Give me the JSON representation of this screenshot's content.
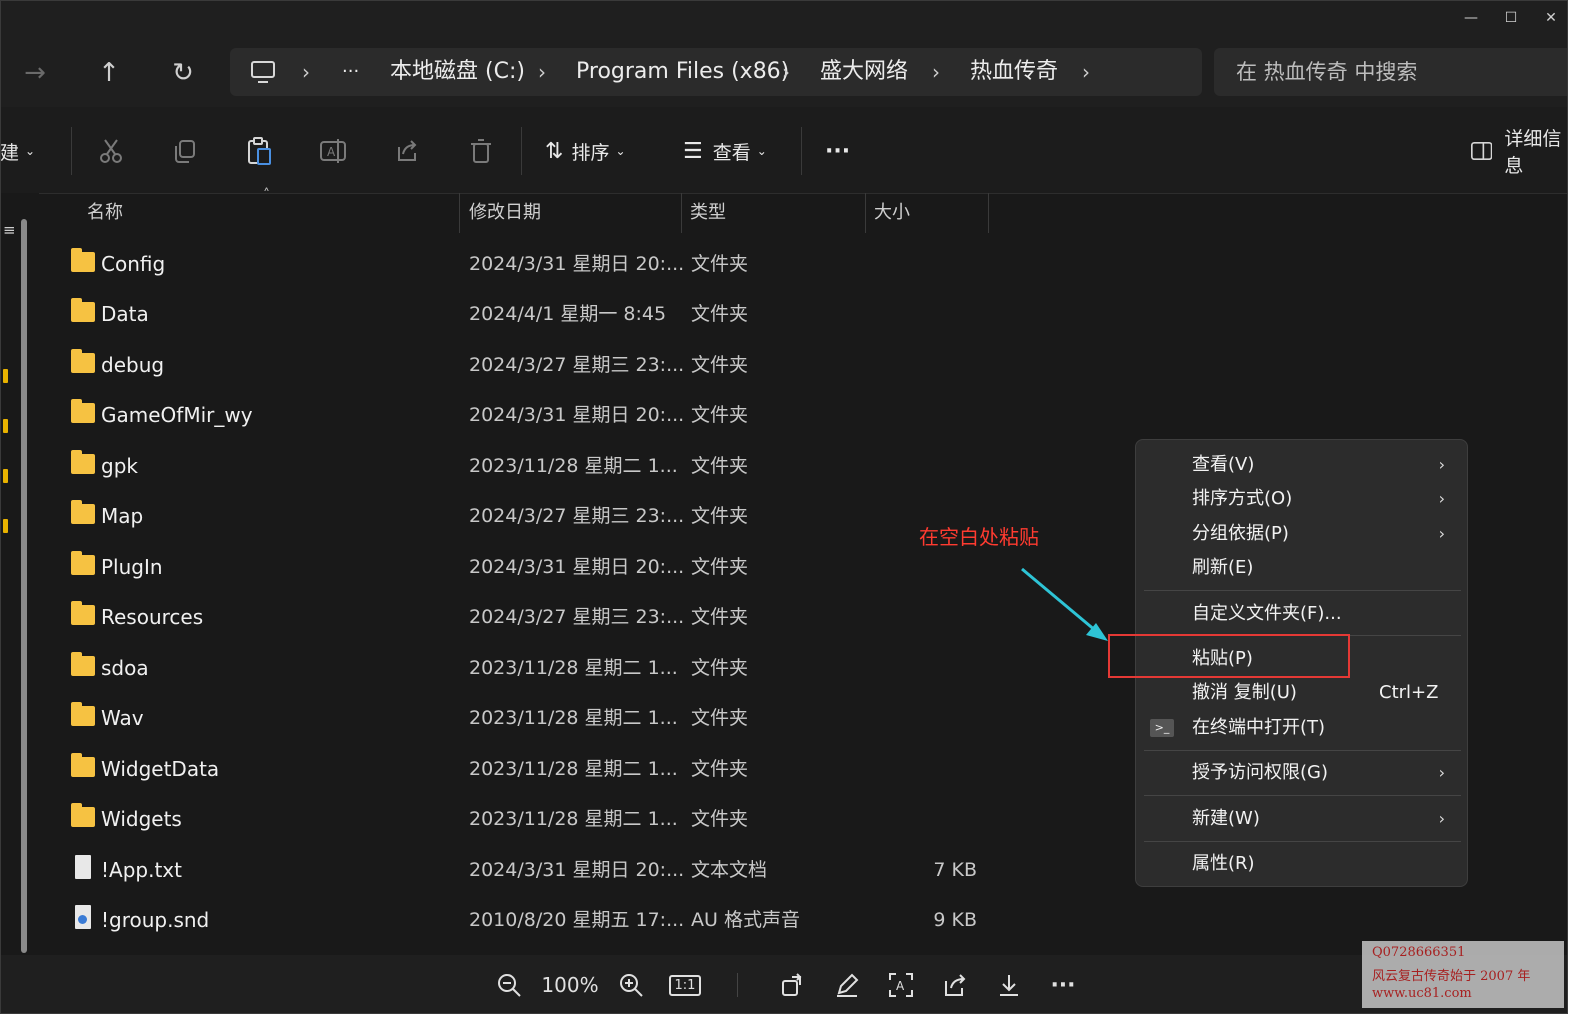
{
  "window": {
    "controls": {
      "minimize": "—",
      "maximize": "☐",
      "close": "✕"
    }
  },
  "nav": {
    "back_icon": "←",
    "forward_icon": "→",
    "up_icon": "↑",
    "refresh_icon": "↻"
  },
  "address": {
    "more": "···",
    "segments": [
      "本地磁盘 (C:)",
      "Program Files (x86)",
      "盛大网络",
      "热血传奇"
    ]
  },
  "search": {
    "placeholder": "在 热血传奇 中搜索"
  },
  "toolbar": {
    "new_label": "新建",
    "sort_label": "排序",
    "view_label": "查看",
    "more_label": "···",
    "details_label": "详细信息"
  },
  "columns": {
    "name": "名称",
    "date": "修改日期",
    "type": "类型",
    "size": "大小"
  },
  "files": [
    {
      "name": "Config",
      "date": "2024/3/31 星期日 20:...",
      "type": "文件夹",
      "size": "",
      "kind": "folder"
    },
    {
      "name": "Data",
      "date": "2024/4/1 星期一 8:45",
      "type": "文件夹",
      "size": "",
      "kind": "folder"
    },
    {
      "name": "debug",
      "date": "2024/3/27 星期三 23:...",
      "type": "文件夹",
      "size": "",
      "kind": "folder"
    },
    {
      "name": "GameOfMir_wy",
      "date": "2024/3/31 星期日 20:...",
      "type": "文件夹",
      "size": "",
      "kind": "folder"
    },
    {
      "name": "gpk",
      "date": "2023/11/28 星期二 1...",
      "type": "文件夹",
      "size": "",
      "kind": "folder"
    },
    {
      "name": "Map",
      "date": "2024/3/27 星期三 23:...",
      "type": "文件夹",
      "size": "",
      "kind": "folder"
    },
    {
      "name": "PlugIn",
      "date": "2024/3/31 星期日 20:...",
      "type": "文件夹",
      "size": "",
      "kind": "folder"
    },
    {
      "name": "Resources",
      "date": "2024/3/27 星期三 23:...",
      "type": "文件夹",
      "size": "",
      "kind": "folder"
    },
    {
      "name": "sdoa",
      "date": "2023/11/28 星期二 1...",
      "type": "文件夹",
      "size": "",
      "kind": "folder"
    },
    {
      "name": "Wav",
      "date": "2023/11/28 星期二 1...",
      "type": "文件夹",
      "size": "",
      "kind": "folder"
    },
    {
      "name": "WidgetData",
      "date": "2023/11/28 星期二 1...",
      "type": "文件夹",
      "size": "",
      "kind": "folder"
    },
    {
      "name": "Widgets",
      "date": "2023/11/28 星期二 1...",
      "type": "文件夹",
      "size": "",
      "kind": "folder"
    },
    {
      "name": "!App.txt",
      "date": "2024/3/31 星期日 20:...",
      "type": "文本文档",
      "size": "7 KB",
      "kind": "text"
    },
    {
      "name": "!group.snd",
      "date": "2010/8/20 星期五 17:...",
      "type": "AU 格式声音",
      "size": "9 KB",
      "kind": "sound"
    }
  ],
  "context_menu": {
    "view": "查看(V)",
    "sort": "排序方式(O)",
    "group": "分组依据(P)",
    "refresh": "刷新(E)",
    "customize": "自定义文件夹(F)...",
    "paste": "粘贴(P)",
    "undo": "撤消 复制(U)",
    "undo_shortcut": "Ctrl+Z",
    "terminal": "在终端中打开(T)",
    "access": "授予访问权限(G)",
    "new": "新建(W)",
    "properties": "属性(R)"
  },
  "annotation": {
    "text": "在空白处粘贴"
  },
  "viewer_bar": {
    "zoom": "100%",
    "actual_size": "1:1",
    "more": "···"
  },
  "watermark": {
    "line1": "Q0728666351",
    "line2": "风云复古传奇始于 2007 年",
    "line3": "www.uc81.com"
  },
  "colors": {
    "folder": "#f6c242",
    "annotation": "#ff3b30",
    "highlight_border": "#e53935",
    "arrow": "#2ec4d6"
  }
}
